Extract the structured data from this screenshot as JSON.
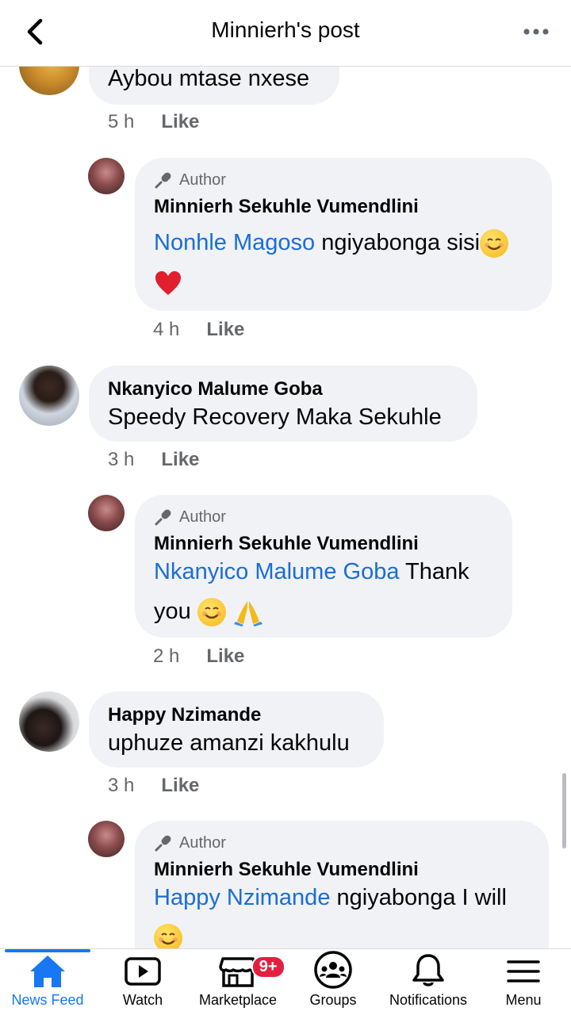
{
  "header": {
    "title": "Minnierh's post"
  },
  "comments": [
    {
      "name": "",
      "text": "Aybou mtase nxese",
      "time": "5 h",
      "like": "Like",
      "reply": {
        "badge": "Author",
        "name": "Minnierh Sekuhle Vumendlini",
        "mention": "Nonhle Magoso",
        "text": " ngiyabonga sisi",
        "time": "4 h",
        "like": "Like"
      }
    },
    {
      "name": "Nkanyico Malume  Goba",
      "text": "Speedy Recovery Maka Sekuhle",
      "time": "3 h",
      "like": "Like",
      "reply": {
        "badge": "Author",
        "name": "Minnierh Sekuhle Vumendlini",
        "mention": "Nkanyico Malume  Goba",
        "text_line1": " Thank",
        "text_line2": "you ",
        "time": "2 h",
        "like": "Like"
      }
    },
    {
      "name": "Happy Nzimande",
      "text": "uphuze amanzi kakhulu",
      "time": "3 h",
      "like": "Like",
      "reply": {
        "badge": "Author",
        "name": "Minnierh Sekuhle Vumendlini",
        "mention": "Happy Nzimande",
        "text": " ngiyabonga I will"
      }
    }
  ],
  "nav": {
    "items": [
      {
        "label": "News Feed",
        "icon": "home-icon",
        "active": true
      },
      {
        "label": "Watch",
        "icon": "watch-icon"
      },
      {
        "label": "Marketplace",
        "icon": "marketplace-icon",
        "badge": "9+"
      },
      {
        "label": "Groups",
        "icon": "groups-icon"
      },
      {
        "label": "Notifications",
        "icon": "bell-icon"
      },
      {
        "label": "Menu",
        "icon": "menu-icon"
      }
    ]
  },
  "colors": {
    "accent": "#1877f2",
    "mention": "#1a6dd6",
    "bubble": "#f0f2f5",
    "muted": "#65676b",
    "badge": "#e41e3f"
  }
}
